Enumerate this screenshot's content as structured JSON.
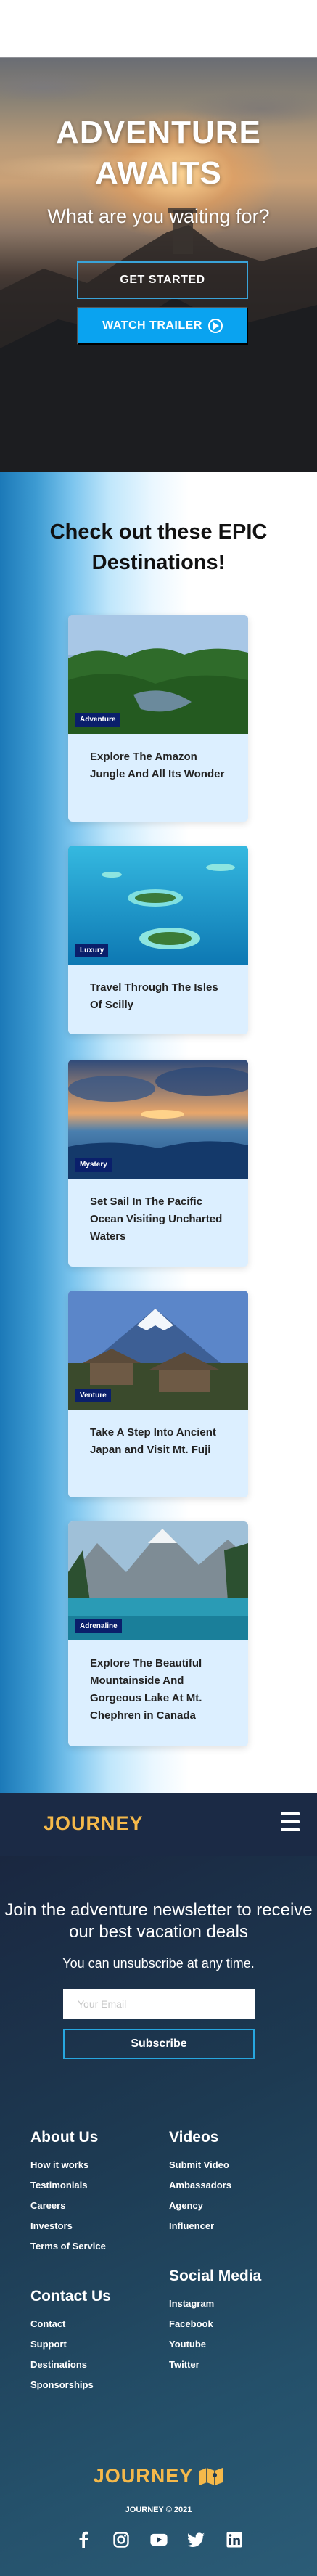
{
  "hero": {
    "title_line1": "ADVENTURE",
    "title_line2": "AWAITS",
    "subtitle": "What are you waiting for?",
    "get_started_label": "GET STARTED",
    "watch_trailer_label": "WATCH TRAILER"
  },
  "destinations": {
    "heading_line1": "Check out these EPIC",
    "heading_line2": "Destinations!",
    "cards": [
      {
        "tag": "Adventure",
        "title": "Explore The Amazon Jungle And All Its Wonder",
        "image_icon": "jungle-image"
      },
      {
        "tag": "Luxury",
        "title": "Travel Through The Isles Of Scilly",
        "image_icon": "islands-image"
      },
      {
        "tag": "Mystery",
        "title": "Set Sail In The Pacific Ocean Visiting Uncharted Waters",
        "image_icon": "ocean-sunset-image"
      },
      {
        "tag": "Venture",
        "title": "Take A Step Into Ancient Japan and Visit Mt. Fuji",
        "image_icon": "mt-fuji-image"
      },
      {
        "tag": "Adrenaline",
        "title": "Explore The Beautiful Mountainside And Gorgeous Lake At Mt. Chephren in Canada",
        "image_icon": "mountain-lake-image"
      }
    ]
  },
  "nav": {
    "logo": "JOURNEY",
    "menu_icon": "hamburger-icon"
  },
  "footer": {
    "newsletter_title": "Join the adventure newsletter to receive our best vacation deals",
    "newsletter_sub": "You can unsubscribe at any time.",
    "email_placeholder": "Your Email",
    "subscribe_label": "Subscribe",
    "about": {
      "heading": "About Us",
      "items": [
        "How it works",
        "Testimonials",
        "Careers",
        "Investors",
        "Terms of Service"
      ]
    },
    "videos": {
      "heading": "Videos",
      "items": [
        "Submit Video",
        "Ambassadors",
        "Agency",
        "Influencer"
      ]
    },
    "contact": {
      "heading": "Contact Us",
      "items": [
        "Contact",
        "Support",
        "Destinations",
        "Sponsorships"
      ]
    },
    "social_media": {
      "heading": "Social Media",
      "items": [
        "Instagram",
        "Facebook",
        "Youtube",
        "Twitter"
      ]
    },
    "logo": "JOURNEY",
    "copyright": "JOURNEY © 2021",
    "social_icons": [
      "facebook-icon",
      "instagram-icon",
      "youtube-icon",
      "twitter-icon",
      "linkedin-icon"
    ]
  },
  "colors": {
    "accent_blue": "#0aa3f0",
    "logo_gold": "#f5b94a",
    "nav_bg": "#1b2a45",
    "card_bg": "#dcefff",
    "tag_bg": "#0a1f6b"
  }
}
